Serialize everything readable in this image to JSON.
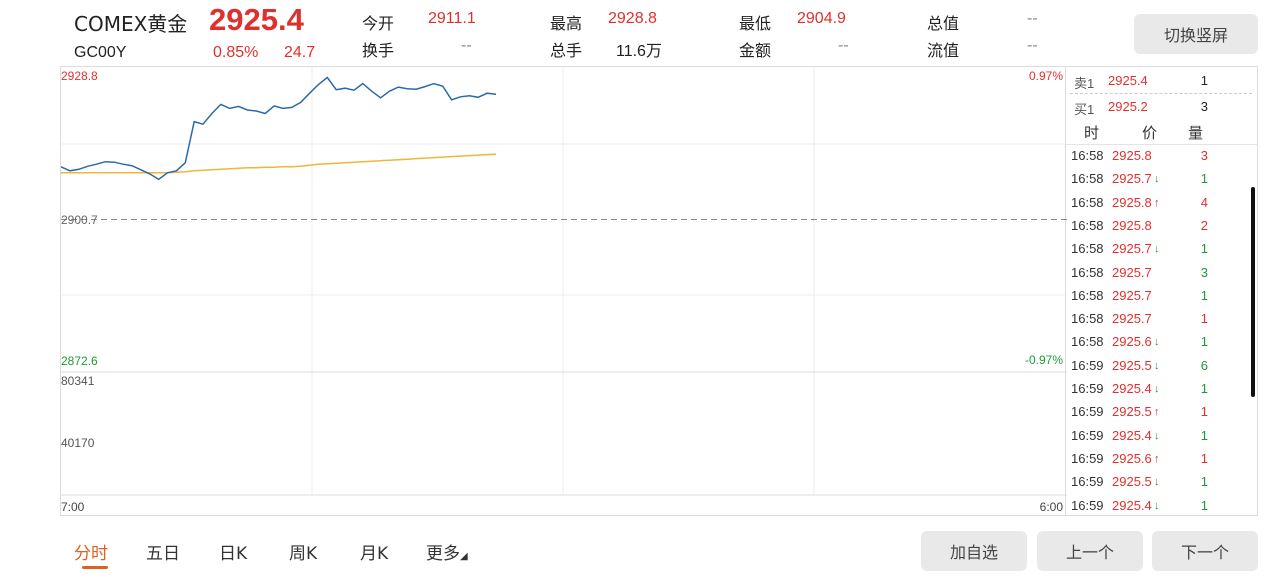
{
  "header": {
    "name": "COMEX黄金",
    "price": "2925.4",
    "code": "GC00Y",
    "change_pct": "0.85%",
    "change": "24.7",
    "stats": [
      {
        "label": "今开",
        "value": "2911.1",
        "color": "red"
      },
      {
        "label": "最高",
        "value": "2928.8",
        "color": "red"
      },
      {
        "label": "最低",
        "value": "2904.9",
        "color": "red"
      },
      {
        "label": "总值",
        "value": "--",
        "color": "gray"
      },
      {
        "label": "换手",
        "value": "--",
        "color": "gray"
      },
      {
        "label": "总手",
        "value": "11.6万",
        "color": "blk"
      },
      {
        "label": "金额",
        "value": "--",
        "color": "gray"
      },
      {
        "label": "流值",
        "value": "--",
        "color": "gray"
      }
    ],
    "switch_label": "切换竖屏"
  },
  "chart": {
    "y_top": "2928.8",
    "y_mid": "2900.7",
    "y_bottom": "2872.6",
    "pct_top": "0.97%",
    "pct_bottom": "-0.97%",
    "vol_top": "80341",
    "vol_mid": "40170",
    "time_start": "7:00",
    "time_end": "6:00",
    "colors": {
      "price": "#2b6aa8",
      "avg": "#f0b63c",
      "up": "#e0302e",
      "down": "#1f9b35"
    }
  },
  "chart_data": {
    "type": "line",
    "title": "",
    "xlabel": "",
    "ylabel": "",
    "ylim": [
      2872.6,
      2928.8
    ],
    "x_range": [
      "7:00",
      "6:00"
    ],
    "prev_close": 2900.7,
    "series": [
      {
        "values": [
          2911.1,
          2910.3,
          2910.6,
          2911.2,
          2911.6,
          2912.1,
          2912.0,
          2911.6,
          2911.3,
          2910.5,
          2909.7,
          2908.6,
          2909.9,
          2910.3,
          2911.9,
          2920.0,
          2919.5,
          2921.6,
          2923.4,
          2922.6,
          2923.0,
          2922.3,
          2922.1,
          2921.6,
          2923.1,
          2922.6,
          2922.8,
          2923.8,
          2925.6,
          2927.3,
          2928.7,
          2926.3,
          2926.6,
          2926.2,
          2927.5,
          2926.0,
          2924.7,
          2926.0,
          2926.8,
          2926.5,
          2926.4,
          2926.9,
          2927.5,
          2927.0,
          2924.3,
          2924.9,
          2925.1,
          2924.8,
          2925.6,
          2925.4
        ]
      },
      {
        "values": [
          2909.9,
          2909.9,
          2909.9,
          2909.9,
          2909.9,
          2909.9,
          2909.9,
          2909.9,
          2909.9,
          2909.9,
          2909.9,
          2909.9,
          2909.9,
          2910.0,
          2910.1,
          2910.3,
          2910.4,
          2910.5,
          2910.6,
          2910.7,
          2910.8,
          2910.9,
          2910.9,
          2911.0,
          2911.0,
          2911.1,
          2911.1,
          2911.2,
          2911.4,
          2911.6,
          2911.7,
          2911.8,
          2911.9,
          2912.0,
          2912.1,
          2912.2,
          2912.3,
          2912.4,
          2912.5,
          2912.6,
          2912.7,
          2912.8,
          2912.9,
          2913.0,
          2913.1,
          2913.2,
          2913.3,
          2913.4,
          2913.5,
          2913.6
        ]
      }
    ]
  },
  "book": {
    "sell": {
      "label": "卖1",
      "price": "2925.4",
      "qty": "1"
    },
    "buy": {
      "label": "买1",
      "price": "2925.2",
      "qty": "3"
    },
    "head": {
      "time": "时",
      "price": "价",
      "qty": "量"
    },
    "ticks": [
      {
        "time": "16:58",
        "price": "2925.8",
        "arrow": "",
        "qty": "3",
        "qcolor": "red"
      },
      {
        "time": "16:58",
        "price": "2925.7",
        "arrow": "↓",
        "qty": "1",
        "qcolor": "green"
      },
      {
        "time": "16:58",
        "price": "2925.8",
        "arrow": "↑",
        "qty": "4",
        "qcolor": "red"
      },
      {
        "time": "16:58",
        "price": "2925.8",
        "arrow": "",
        "qty": "2",
        "qcolor": "red"
      },
      {
        "time": "16:58",
        "price": "2925.7",
        "arrow": "↓",
        "qty": "1",
        "qcolor": "green"
      },
      {
        "time": "16:58",
        "price": "2925.7",
        "arrow": "",
        "qty": "3",
        "qcolor": "green"
      },
      {
        "time": "16:58",
        "price": "2925.7",
        "arrow": "",
        "qty": "1",
        "qcolor": "green"
      },
      {
        "time": "16:58",
        "price": "2925.7",
        "arrow": "",
        "qty": "1",
        "qcolor": "red"
      },
      {
        "time": "16:58",
        "price": "2925.6",
        "arrow": "↓",
        "qty": "1",
        "qcolor": "green"
      },
      {
        "time": "16:59",
        "price": "2925.5",
        "arrow": "↓",
        "qty": "6",
        "qcolor": "green"
      },
      {
        "time": "16:59",
        "price": "2925.4",
        "arrow": "↓",
        "qty": "1",
        "qcolor": "green"
      },
      {
        "time": "16:59",
        "price": "2925.5",
        "arrow": "↑",
        "qty": "1",
        "qcolor": "red"
      },
      {
        "time": "16:59",
        "price": "2925.4",
        "arrow": "↓",
        "qty": "1",
        "qcolor": "green"
      },
      {
        "time": "16:59",
        "price": "2925.6",
        "arrow": "↑",
        "qty": "1",
        "qcolor": "red"
      },
      {
        "time": "16:59",
        "price": "2925.5",
        "arrow": "↓",
        "qty": "1",
        "qcolor": "green"
      },
      {
        "time": "16:59",
        "price": "2925.4",
        "arrow": "↓",
        "qty": "1",
        "qcolor": "green"
      }
    ]
  },
  "tabs": [
    "分时",
    "五日",
    "日K",
    "周K",
    "月K",
    "更多"
  ],
  "buttons": {
    "add": "加自选",
    "prev": "上一个",
    "next": "下一个"
  }
}
